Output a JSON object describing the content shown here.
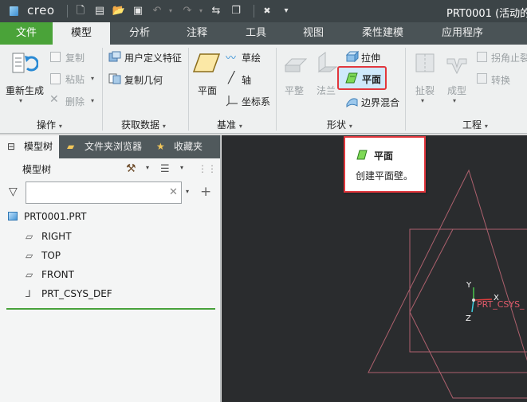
{
  "app": {
    "logo": "creo",
    "window_title": "PRT0001 (活动的"
  },
  "quick_access": [
    {
      "icon": "new-file-icon",
      "glyph": "🗋"
    },
    {
      "icon": "open-folder-icon",
      "glyph": "▤"
    },
    {
      "icon": "save-icon",
      "glyph": "▣"
    },
    {
      "icon": "undo-icon",
      "glyph": "↶"
    },
    {
      "icon": "redo-icon",
      "glyph": "↷"
    },
    {
      "icon": "regenerate-icon",
      "glyph": "⇆"
    },
    {
      "icon": "window-icon",
      "glyph": "❐"
    },
    {
      "icon": "close-window-icon",
      "glyph": "✖"
    },
    {
      "icon": "customize-dropdown-icon",
      "glyph": "▾"
    }
  ],
  "tabs": [
    {
      "label": "文件",
      "state": "file"
    },
    {
      "label": "模型",
      "state": "active"
    },
    {
      "label": "分析"
    },
    {
      "label": "注释"
    },
    {
      "label": "工具"
    },
    {
      "label": "视图"
    },
    {
      "label": "柔性建模"
    },
    {
      "label": "应用程序"
    }
  ],
  "ribbon": {
    "operations": {
      "regenerate": "重新生成",
      "copy": "复制",
      "paste": "粘贴",
      "delete": "删除",
      "group_label": "操作"
    },
    "get_data": {
      "user_defined_feature": "用户定义特征",
      "copy_geometry": "复制几何",
      "group_label": "获取数据"
    },
    "datum": {
      "plane": "平面",
      "sketch": "草绘",
      "axis": "轴",
      "csys": "坐标系",
      "group_label": "基准"
    },
    "shapes": {
      "flat": "平整",
      "flange": "法兰",
      "extrude": "拉伸",
      "planar": "平面",
      "blend": "边界混合",
      "group_label": "形状"
    },
    "engineering": {
      "rip": "扯裂",
      "form": "成型",
      "corner_relief": "拐角止裂",
      "convert": "转换",
      "group_label": "工程"
    }
  },
  "tooltip": {
    "title": "平面",
    "description": "创建平面壁。"
  },
  "panel": {
    "tabs": [
      {
        "label": "模型树"
      },
      {
        "label": "文件夹浏览器"
      },
      {
        "label": "收藏夹"
      }
    ],
    "header": "模型树",
    "search": {
      "value": "",
      "placeholder": ""
    },
    "tree": [
      {
        "label": "PRT0001.PRT",
        "icon": "part-icon"
      },
      {
        "label": "RIGHT",
        "icon": "datum-plane-icon"
      },
      {
        "label": "TOP",
        "icon": "datum-plane-icon"
      },
      {
        "label": "FRONT",
        "icon": "datum-plane-icon"
      },
      {
        "label": "PRT_CSYS_DEF",
        "icon": "csys-icon"
      }
    ]
  },
  "viewport": {
    "csys_label": "PRT_CSYS_",
    "axes": {
      "x": "X",
      "y": "Y",
      "z": "Z"
    }
  },
  "colors": {
    "accent_green": "#4aa339",
    "highlight_red": "#e2373d",
    "datum_plane": "#c46a78",
    "viewport_bg": "#2a2c2e"
  }
}
